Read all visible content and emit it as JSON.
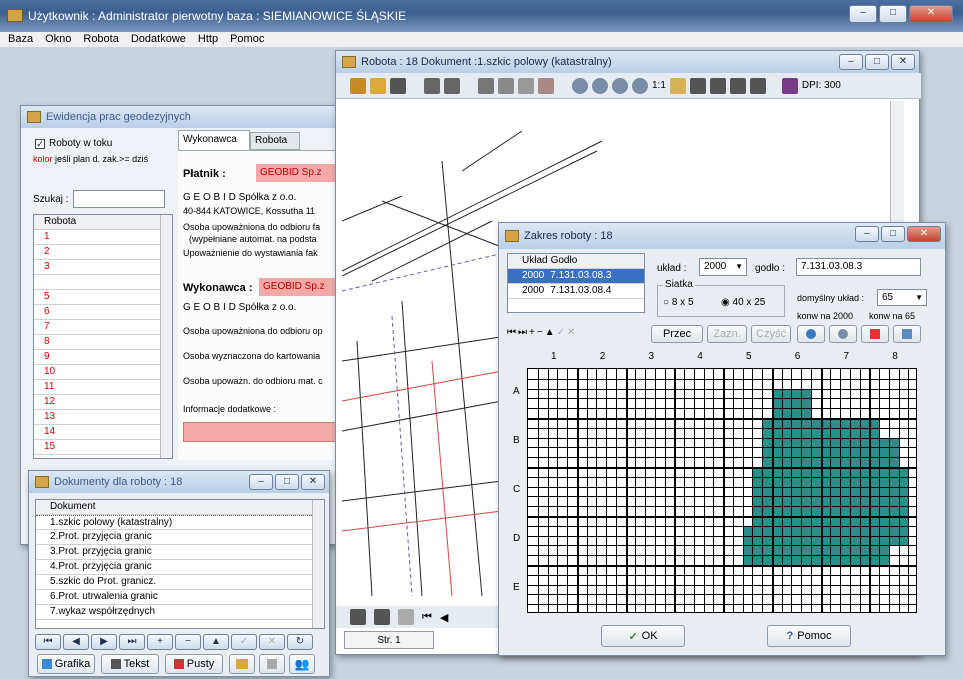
{
  "app": {
    "title": "Użytkownik : Administrator pierwotny    baza : SIEMIANOWICE ŚLĄSKIE",
    "menu": [
      "Baza",
      "Okno",
      "Robota",
      "Dodatkowe",
      "Http",
      "Pomoc"
    ]
  },
  "ewidencja": {
    "title": "Ewidencja prac geodezyjnych",
    "chk_label": "Roboty w toku",
    "kolor_word": "kolor",
    "kolor_rest": "jeśli plan d. zak.>= dziś",
    "search_label": "Szukaj :",
    "col_header": "Robota",
    "rows": [
      "1",
      "2",
      "3",
      "",
      "5",
      "6",
      "7",
      "8",
      "9",
      "10",
      "11",
      "12",
      "13",
      "14",
      "15"
    ],
    "tab_wykonawca": "Wykonawca",
    "tab_robota": "Robota",
    "platnik_label": "Płatnik :",
    "platnik_value": "GEOBID   Sp.z",
    "platnik_name": "G E O B I D  Spółka z o.o.",
    "platnik_addr": "40-844 KATOWICE, Kossutha 11",
    "osoba1": "Osoba upoważniona do odbioru fa",
    "osoba1b": "(wypełniane automat. na podsta",
    "upow": "Upoważnienie do wystawiania  fak",
    "wykonawca_label": "Wykonawca :",
    "wykonawca_value": "GEOBID   Sp.z",
    "wykonawca_name": "G E O B I D  Spółka z o.o.",
    "osoba2": "Osoba upoważniona do odbioru op",
    "osoba3": "Osoba wyznaczona do kartowania",
    "osoba4": "Osoba upoważn. do odbioru mat. c",
    "info": "Informacje dodatkowe :"
  },
  "dokumenty": {
    "title": "Dokumenty dla roboty : 18",
    "col_header": "Dokument",
    "rows": [
      "1.szkic polowy (katastralny)",
      "2.Prot. przyjęcia granic",
      "3.Prot. przyjęcia granic",
      "4.Prot. przyjęcia granic",
      "5.szkic do Prot. granicz.",
      "6.Prot. utrwalenia granic",
      "7.wykaz współrzędnych"
    ],
    "btn_grafika": "Grafika",
    "btn_tekst": "Tekst",
    "btn_pusty": "Pusty"
  },
  "robota": {
    "title": "Robota : 18   Dokument :1.szkic polowy (katastralny)",
    "zoom_11": "1:1",
    "dpi": "DPI: 300",
    "str": "Str. 1"
  },
  "zakres": {
    "title": "Zakres roboty : 18",
    "col_uklad": "Układ",
    "col_godlo": "Godło",
    "rows": [
      {
        "uklad": "2000",
        "godlo": "7.131.03.08.3"
      },
      {
        "uklad": "2000",
        "godlo": "7.131.03.08.4"
      }
    ],
    "uklad_label": "układ :",
    "uklad_value": "2000",
    "godlo_label": "godło :",
    "godlo_value": "7.131.03.08.3",
    "siatka_label": "Siatka",
    "opt1": "8 x 5",
    "opt2": "40 x 25",
    "domyslny_label": "domyślny układ :",
    "domyslny_value": "65",
    "konw1": "konw na 2000",
    "konw2": "konw na 65",
    "btn_przec": "Przec",
    "btn_zazn": "Zazn.",
    "btn_czysc": "Czyść",
    "cols": [
      "1",
      "2",
      "3",
      "4",
      "5",
      "6",
      "7",
      "8"
    ],
    "rows_lbl": [
      "A",
      "B",
      "C",
      "D",
      "E"
    ],
    "ok": "OK",
    "pomoc": "Pomoc"
  },
  "colors": {
    "fill": "#2b8f8c",
    "title_blue": "#1b2a44",
    "red": "#d20000"
  }
}
